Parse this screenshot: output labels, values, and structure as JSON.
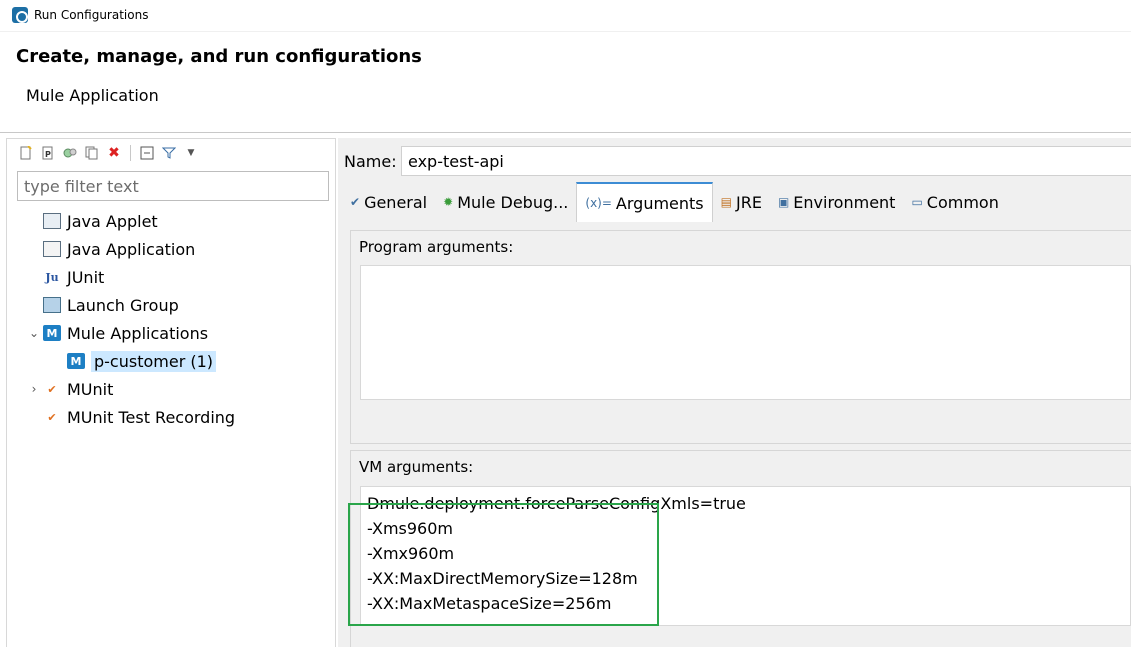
{
  "window": {
    "title": "Run Configurations"
  },
  "header": {
    "title": "Create, manage, and run configurations",
    "subtitle": "Mule Application"
  },
  "filter": {
    "placeholder": "type filter text"
  },
  "tree": {
    "items": [
      {
        "label": "Java Applet"
      },
      {
        "label": "Java Application"
      },
      {
        "label": "JUnit"
      },
      {
        "label": "Launch Group"
      },
      {
        "label": "Mule Applications"
      },
      {
        "label": "p-customer (1)"
      },
      {
        "label": "MUnit"
      },
      {
        "label": "MUnit Test Recording"
      }
    ]
  },
  "config": {
    "name_label": "Name:",
    "name_value": "exp-test-api"
  },
  "tabs": [
    {
      "label": "General"
    },
    {
      "label": "Mule Debug..."
    },
    {
      "label": "Arguments"
    },
    {
      "label": "JRE"
    },
    {
      "label": "Environment"
    },
    {
      "label": "Common"
    }
  ],
  "arguments": {
    "program_label": "Program arguments:",
    "vm_label": "VM arguments:",
    "vm_lines": [
      "Dmule.deployment.forceParseConfigXmls=true",
      "-Xms960m",
      "-Xmx960m",
      "-XX:MaxDirectMemorySize=128m",
      "-XX:MaxMetaspaceSize=256m"
    ]
  },
  "colors": {
    "highlight": "#2aa54a",
    "selection": "#cce8ff",
    "active_tab_accent": "#3c8cd4"
  }
}
